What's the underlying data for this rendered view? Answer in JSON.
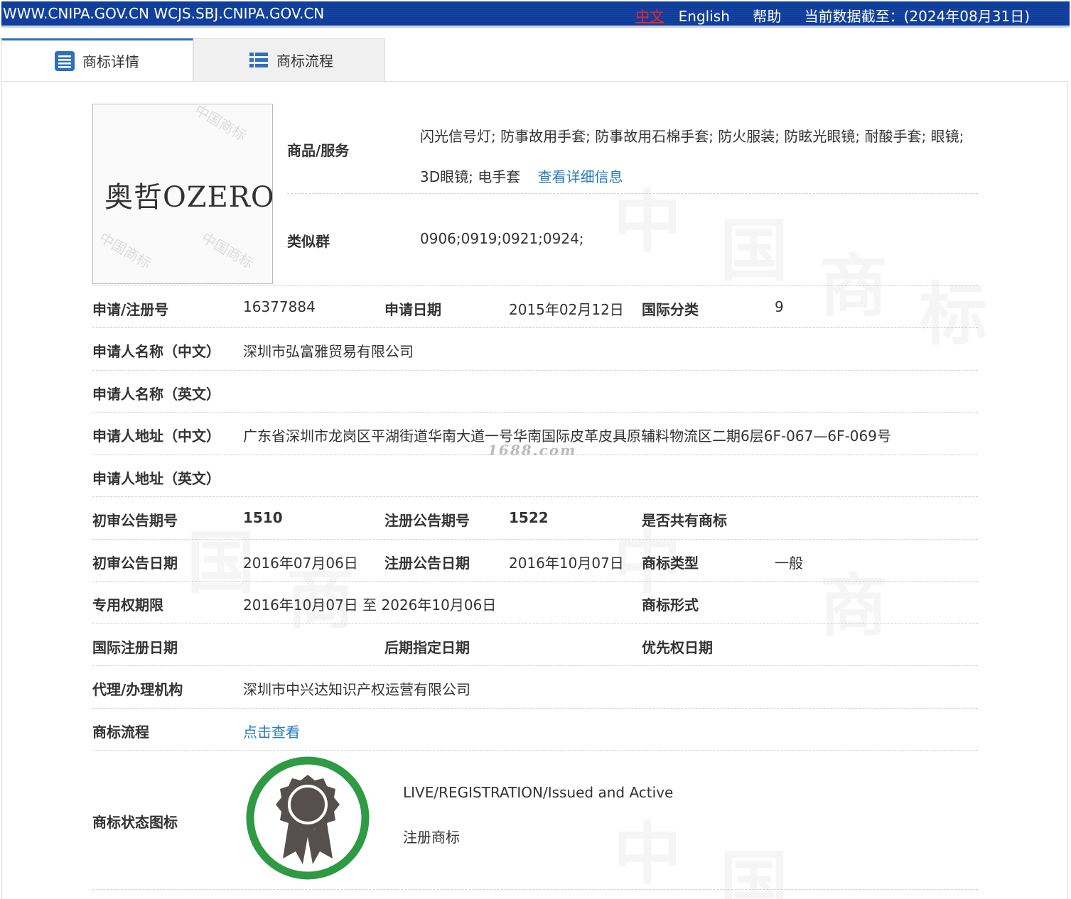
{
  "topbar": {
    "domains": "WWW.CNIPA.GOV.CN WCJS.SBJ.CNIPA.GOV.CN",
    "lang_zh": "中文",
    "lang_en": "English",
    "help": "帮助",
    "data_cutoff": "当前数据截至：(2024年08月31日)"
  },
  "tabs": [
    {
      "label": "商标详情",
      "icon": "document-list-icon",
      "active": true
    },
    {
      "label": "商标流程",
      "icon": "grid-list-icon",
      "active": false
    }
  ],
  "mark": {
    "text": "奥哲OZERO",
    "stamp_text": "中国商标"
  },
  "watermark": {
    "chars": [
      "中",
      "国",
      "商",
      "标"
    ]
  },
  "goods": {
    "label": "商品/服务",
    "value": "闪光信号灯; 防事故用手套; 防事故用石棉手套; 防火服装; 防眩光眼镜; 耐酸手套; 眼镜; 3D眼镜; 电手套",
    "detail_link": "查看详细信息"
  },
  "similar_group": {
    "label": "类似群",
    "value": "0906;0919;0921;0924;"
  },
  "fields": {
    "reg_no_label": "申请/注册号",
    "reg_no": "16377884",
    "apply_date_label": "申请日期",
    "apply_date": "2015年02月12日",
    "intl_class_label": "国际分类",
    "intl_class": "9",
    "applicant_cn_label": "申请人名称（中文）",
    "applicant_cn": "深圳市弘富雅贸易有限公司",
    "applicant_en_label": "申请人名称（英文）",
    "applicant_en": "",
    "address_cn_label": "申请人地址（中文）",
    "address_cn": "广东省深圳市龙岗区平湖街道华南大道一号华南国际皮革皮具原辅料物流区二期6层6F-067—6F-069号",
    "address_watermark": "1688.com",
    "address_en_label": "申请人地址（英文）",
    "address_en": "",
    "prelim_no_label": "初审公告期号",
    "prelim_no": "1510",
    "reg_pub_no_label": "注册公告期号",
    "reg_pub_no": "1522",
    "shared_label": "是否共有商标",
    "shared": "",
    "prelim_date_label": "初审公告日期",
    "prelim_date": "2016年07月06日",
    "reg_pub_date_label": "注册公告日期",
    "reg_pub_date": "2016年10月07日",
    "mark_type_label": "商标类型",
    "mark_type": "一般",
    "exclusive_label": "专用权期限",
    "exclusive": "2016年10月07日 至 2026年10月06日",
    "mark_form_label": "商标形式",
    "mark_form": "",
    "intl_reg_date_label": "国际注册日期",
    "intl_reg_date": "",
    "later_date_label": "后期指定日期",
    "later_date": "",
    "priority_date_label": "优先权日期",
    "priority_date": "",
    "agent_label": "代理/办理机构",
    "agent": "深圳市中兴达知识产权运营有限公司",
    "process_label": "商标流程",
    "process_link": "点击查看",
    "status_label": "商标状态图标",
    "status_en": "LIVE/REGISTRATION/Issued and Active",
    "status_cn": "注册商标"
  },
  "colors": {
    "topbar": "#0d3c9a",
    "link": "#2a7bbf",
    "badge_ring": "#2e9a44",
    "badge_body": "#55504d"
  }
}
